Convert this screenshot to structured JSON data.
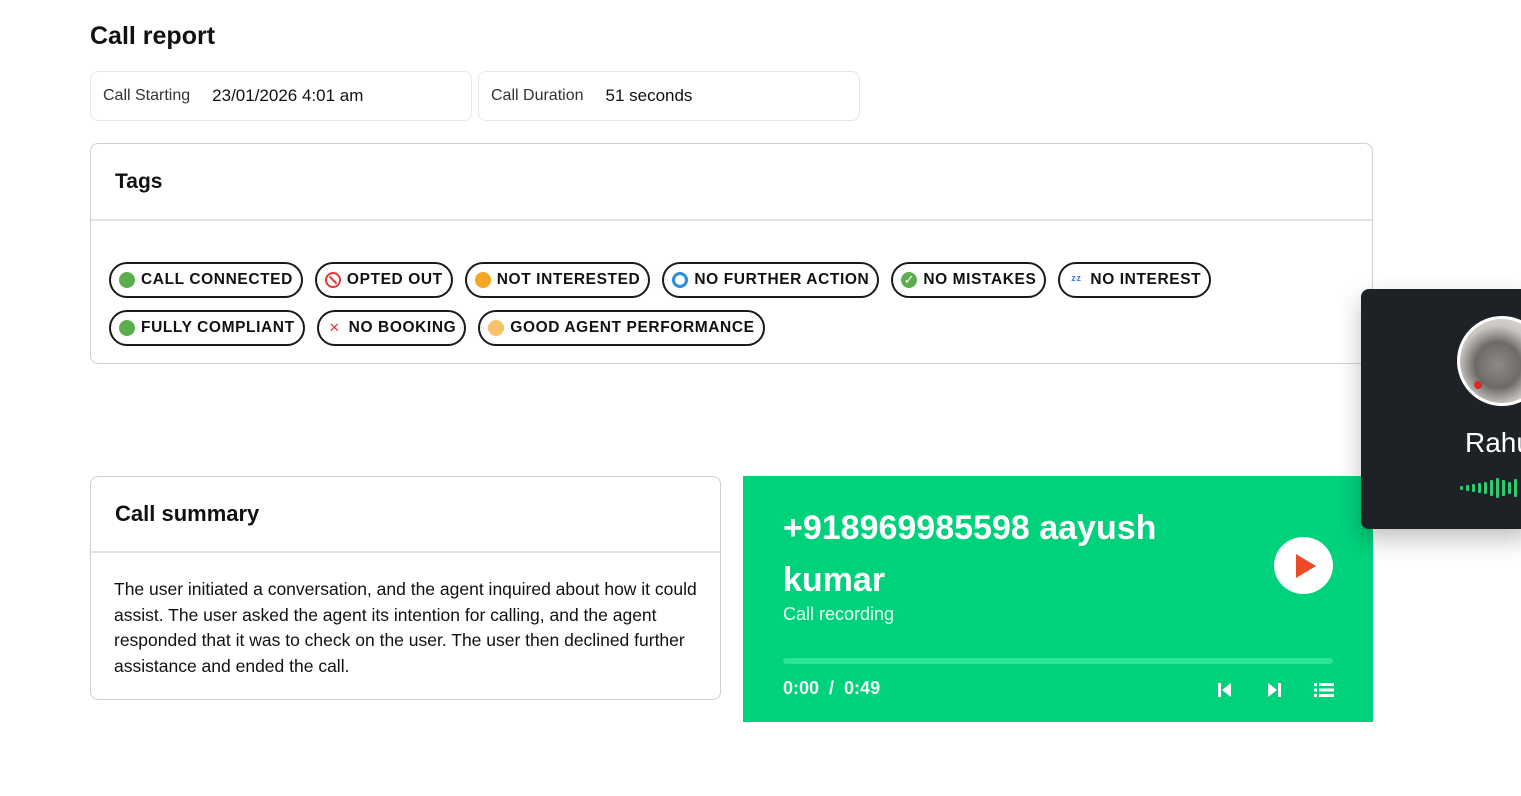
{
  "page": {
    "title": "Call report"
  },
  "info": {
    "start_label": "Call Starting",
    "start_value": "23/01/2026 4:01 am",
    "duration_label": "Call Duration",
    "duration_value": "51 seconds"
  },
  "tags": {
    "heading": "Tags",
    "items": [
      {
        "label": "CALL CONNECTED",
        "icon": "green-circle-icon"
      },
      {
        "label": "OPTED OUT",
        "icon": "prohibited-icon"
      },
      {
        "label": "NOT INTERESTED",
        "icon": "person-shrug-icon"
      },
      {
        "label": "NO FURTHER ACTION",
        "icon": "stop-square-icon"
      },
      {
        "label": "NO MISTAKES",
        "icon": "check-mark-icon"
      },
      {
        "label": "NO INTEREST",
        "icon": "sleeping-zzz-icon"
      },
      {
        "label": "FULLY COMPLIANT",
        "icon": "green-circle-icon"
      },
      {
        "label": "NO BOOKING",
        "icon": "cross-mark-icon"
      },
      {
        "label": "GOOD AGENT PERFORMANCE",
        "icon": "thumbs-up-icon"
      }
    ]
  },
  "summary": {
    "heading": "Call summary",
    "text": "The user initiated a conversation, and the agent inquired about how it could assist. The user asked the agent its intention for calling, and the agent responded that it was to check on the user. The user then declined further assistance and ended the call."
  },
  "player": {
    "caller": "+918969985598 aayush kumar",
    "subtitle": "Call recording",
    "current_time": "0:00",
    "separator": "/",
    "total_time": "0:49",
    "progress": 0,
    "accent": "#00d27c",
    "play_icon_color": "#ee4a2a"
  },
  "popup": {
    "name": "Rahu"
  }
}
